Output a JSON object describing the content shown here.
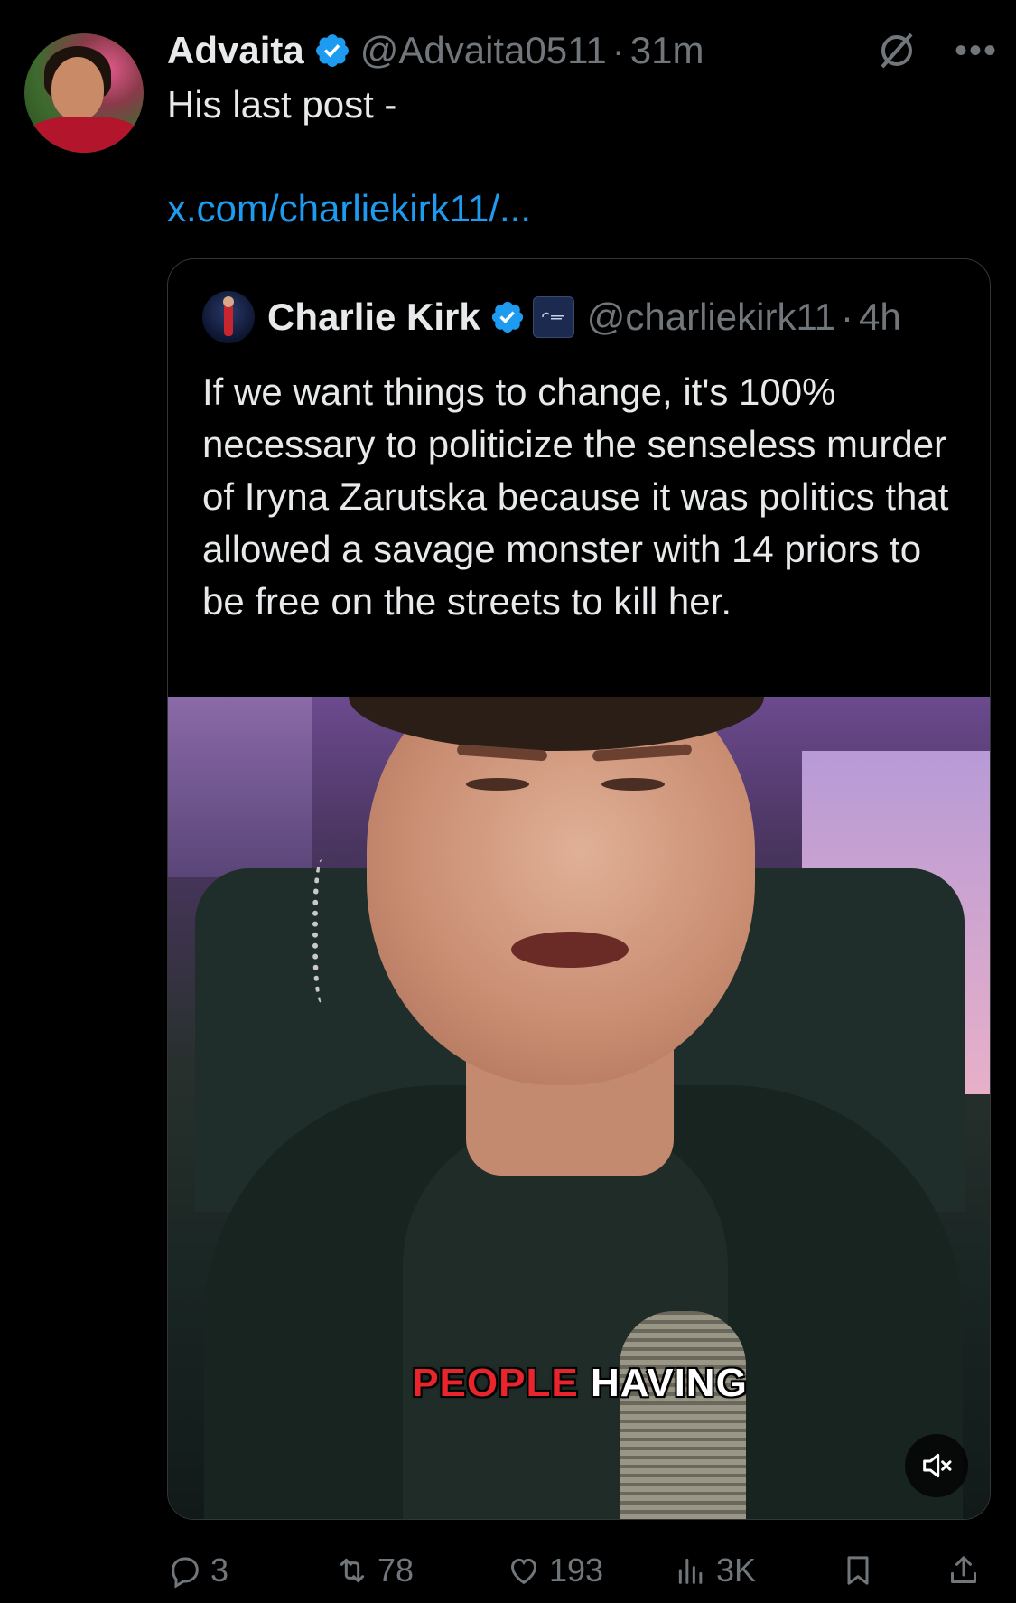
{
  "post": {
    "author_name": "Advaita",
    "author_handle": "@Advaita0511",
    "separator": "·",
    "time": "31m",
    "text": "His last post -",
    "link": "x.com/charliekirk11/..."
  },
  "quoted": {
    "author_name": "Charlie Kirk",
    "author_handle": "@charliekirk11",
    "separator": "·",
    "time": "4h",
    "text": "If we want things to change, it's 100% necessary to politicize the senseless murder of Iryna Zarutska because it was politics that allowed a savage monster with 14 priors to be free on the streets to kill her.",
    "caption_word1": "PEOPLE",
    "caption_word2": "HAVING"
  },
  "actions": {
    "replies": "3",
    "reposts": "78",
    "likes": "193",
    "views": "3K"
  },
  "icons": {
    "verified": "verified-badge-icon",
    "grok": "grok-icon",
    "more": "more-icon",
    "reply": "reply-icon",
    "repost": "repost-icon",
    "like": "heart-icon",
    "views": "views-icon",
    "bookmark": "bookmark-icon",
    "share": "share-icon",
    "mute": "muted-speaker-icon"
  },
  "colors": {
    "background": "#000000",
    "text": "#e7e9ea",
    "secondary": "#71767b",
    "link": "#1d9bf0",
    "verified": "#1d9bf0",
    "caption_red": "#e8242c"
  }
}
